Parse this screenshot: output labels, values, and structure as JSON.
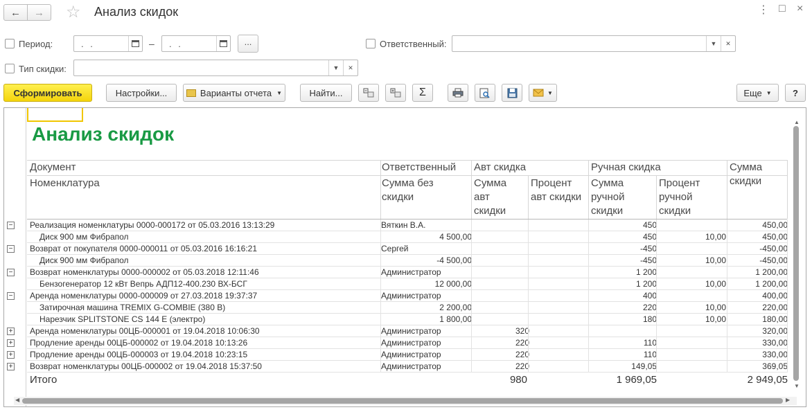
{
  "window": {
    "title": "Анализ скидок",
    "menu_glyph": "⋮",
    "maximize_glyph": "□",
    "close_glyph": "×"
  },
  "filters": {
    "period_label": "Период:",
    "period_from": ". .",
    "period_to": ". .",
    "period_dash": "–",
    "period_more": "...",
    "responsible_label": "Ответственный:",
    "responsible_value": "",
    "discount_type_label": "Тип скидки:",
    "discount_type_value": ""
  },
  "toolbar": {
    "generate": "Сформировать",
    "settings": "Настройки...",
    "variants": "Варианты отчета",
    "find": "Найти...",
    "more": "Еще",
    "help": "?"
  },
  "report": {
    "title": "Анализ скидок",
    "headers": {
      "document": "Документ",
      "nomenclature": "Номенклатура",
      "responsible": "Ответственный",
      "sum_without_discount": "Сумма без скидки",
      "auto_discount": "Авт скидка",
      "auto_sum": "Сумма авт скидки",
      "auto_percent": "Процент авт скидки",
      "manual_discount": "Ручная скидка",
      "manual_sum": "Сумма ручной скидки",
      "manual_percent": "Процент ручной скидки",
      "discount_sum": "Сумма скидки"
    },
    "rows": [
      {
        "level": 0,
        "toggle": "−",
        "name": "Реализация номенклатуры 0000-000172 от 05.03.2016 13:13:29",
        "resp": "Вяткин В.А.",
        "auto_sum": "",
        "manual_sum": "450",
        "manual_pct": "",
        "total": "450,00"
      },
      {
        "level": 1,
        "toggle": "",
        "name": "Диск 900 мм Фибрапол",
        "resp": "4 500,00",
        "auto_sum": "",
        "manual_sum": "450",
        "manual_pct": "10,00",
        "total": "450,00"
      },
      {
        "level": 0,
        "toggle": "−",
        "name": "Возврат от покупателя 0000-000011 от 05.03.2016 16:16:21",
        "resp": "Сергей",
        "auto_sum": "",
        "manual_sum": "-450",
        "manual_pct": "",
        "total": "-450,00"
      },
      {
        "level": 1,
        "toggle": "",
        "name": "Диск 900 мм Фибрапол",
        "resp": "-4 500,00",
        "auto_sum": "",
        "manual_sum": "-450",
        "manual_pct": "10,00",
        "total": "-450,00"
      },
      {
        "level": 0,
        "toggle": "−",
        "name": "Возврат номенклатуры 0000-000002 от 05.03.2018 12:11:46",
        "resp": "Администратор",
        "auto_sum": "",
        "manual_sum": "1 200",
        "manual_pct": "",
        "total": "1 200,00"
      },
      {
        "level": 1,
        "toggle": "",
        "name": "Бензогенератор 12 кВт Вепрь АДП12-400.230 ВХ-БСГ",
        "resp": "12 000,00",
        "auto_sum": "",
        "manual_sum": "1 200",
        "manual_pct": "10,00",
        "total": "1 200,00"
      },
      {
        "level": 0,
        "toggle": "−",
        "name": "Аренда номенклатуры 0000-000009 от 27.03.2018 19:37:37",
        "resp": "Администратор",
        "auto_sum": "",
        "manual_sum": "400",
        "manual_pct": "",
        "total": "400,00"
      },
      {
        "level": 1,
        "toggle": "",
        "name": "Затирочная машина TREMIX G-COMBIE (380 В)",
        "resp": "2 200,00",
        "auto_sum": "",
        "manual_sum": "220",
        "manual_pct": "10,00",
        "total": "220,00"
      },
      {
        "level": 1,
        "toggle": "",
        "name": "Нарезчик SPLITSTONE CS 144 E (электро)",
        "resp": "1 800,00",
        "auto_sum": "",
        "manual_sum": "180",
        "manual_pct": "10,00",
        "total": "180,00"
      },
      {
        "level": 0,
        "toggle": "+",
        "name": "Аренда номенклатуры 00ЦБ-000001 от 19.04.2018 10:06:30",
        "resp": "Администратор",
        "auto_sum": "320",
        "manual_sum": "",
        "manual_pct": "",
        "total": "320,00"
      },
      {
        "level": 0,
        "toggle": "+",
        "name": "Продление аренды 00ЦБ-000002 от 19.04.2018 10:13:26",
        "resp": "Администратор",
        "auto_sum": "220",
        "manual_sum": "110",
        "manual_pct": "",
        "total": "330,00"
      },
      {
        "level": 0,
        "toggle": "+",
        "name": "Продление аренды 00ЦБ-000003 от 19.04.2018 10:23:15",
        "resp": "Администратор",
        "auto_sum": "220",
        "manual_sum": "110",
        "manual_pct": "",
        "total": "330,00"
      },
      {
        "level": 0,
        "toggle": "+",
        "name": "Возврат номенклатуры 00ЦБ-000002 от 19.04.2018 15:37:50",
        "resp": "Администратор",
        "auto_sum": "220",
        "manual_sum": "149,05",
        "manual_pct": "",
        "total": "369,05"
      }
    ],
    "totals": {
      "label": "Итого",
      "auto_sum": "980",
      "manual_sum": "1 969,05",
      "total": "2 949,05"
    }
  },
  "colors": {
    "accent": "#f4d40c",
    "report_title": "#199a44"
  }
}
